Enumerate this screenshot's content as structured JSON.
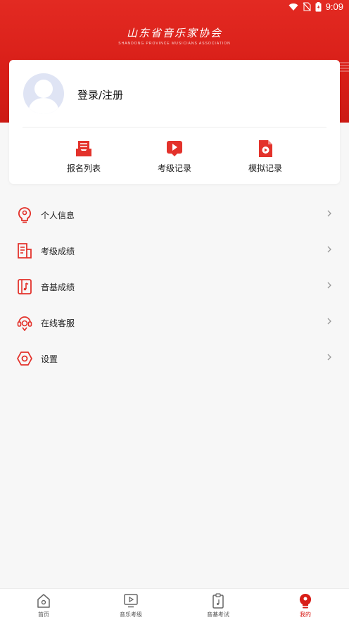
{
  "status_bar": {
    "time": "9:09"
  },
  "header": {
    "logo_text": "山东省音乐家协会",
    "logo_subtext": "SHANDONG PROVINCE MUSICIANS ASSOCIATION"
  },
  "profile": {
    "login_label": "登录/注册"
  },
  "quick_actions": [
    {
      "label": "报名列表",
      "icon": "inbox-icon"
    },
    {
      "label": "考级记录",
      "icon": "video-play-icon"
    },
    {
      "label": "模拟记录",
      "icon": "document-play-icon"
    }
  ],
  "menu": [
    {
      "label": "个人信息",
      "icon": "bulb-person-icon"
    },
    {
      "label": "考级成绩",
      "icon": "report-icon"
    },
    {
      "label": "音基成绩",
      "icon": "music-note-doc-icon"
    },
    {
      "label": "在线客服",
      "icon": "headset-icon"
    },
    {
      "label": "设置",
      "icon": "settings-icon"
    }
  ],
  "tabbar": [
    {
      "label": "首页",
      "icon": "home-icon",
      "active": false
    },
    {
      "label": "音乐考级",
      "icon": "play-screen-icon",
      "active": false
    },
    {
      "label": "音基考试",
      "icon": "clipboard-music-icon",
      "active": false
    },
    {
      "label": "我的",
      "icon": "profile-icon",
      "active": true
    }
  ],
  "colors": {
    "brand_red": "#d81e18",
    "icon_red": "#e3322b",
    "background": "#f7f7f7"
  }
}
